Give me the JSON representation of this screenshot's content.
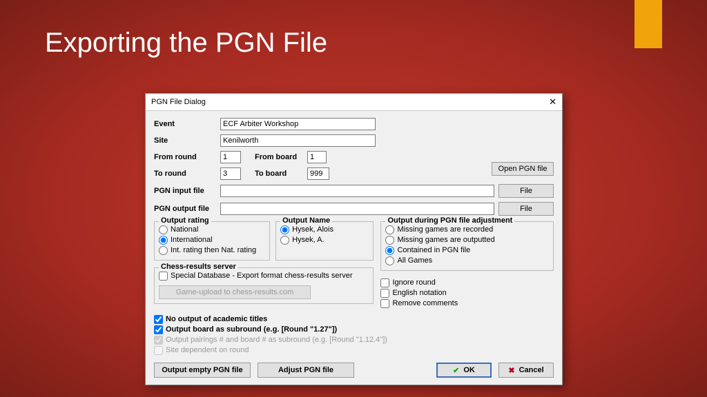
{
  "slide": {
    "title": "Exporting the PGN File"
  },
  "dialog": {
    "title": "PGN File Dialog",
    "labels": {
      "event": "Event",
      "site": "Site",
      "from_round": "From round",
      "from_board": "From board",
      "to_round": "To round",
      "to_board": "To board",
      "pgn_input": "PGN input file",
      "pgn_output": "PGN output file"
    },
    "values": {
      "event": "ECF Arbiter Workshop",
      "site": "Kenilworth",
      "from_round": "1",
      "from_board": "1",
      "to_round": "3",
      "to_board": "999",
      "pgn_input": "",
      "pgn_output": ""
    },
    "buttons": {
      "open_pgn": "Open PGN file",
      "file": "File",
      "upload": "Game-upload to chess-results.com",
      "output_empty": "Output empty PGN file",
      "adjust": "Adjust PGN file",
      "ok": "OK",
      "cancel": "Cancel"
    },
    "groups": {
      "output_rating": {
        "legend": "Output rating",
        "options": [
          "National",
          "International",
          "Int. rating then Nat. rating"
        ],
        "selected": 1
      },
      "output_name": {
        "legend": "Output Name",
        "options": [
          "Hysek, Alois",
          "Hysek, A."
        ],
        "selected": 0
      },
      "output_adj": {
        "legend": "Output during PGN file adjustment",
        "options": [
          "Missing games are recorded",
          "Missing games are outputted",
          "Contained in PGN file",
          "All Games"
        ],
        "selected": 2
      },
      "chess_results": {
        "legend": "Chess-results server",
        "special_db": "Special Database - Export format chess-results server",
        "special_db_checked": false
      },
      "extra_checks": {
        "ignore_round": {
          "label": "Ignore round",
          "checked": false
        },
        "english_notation": {
          "label": "English notation",
          "checked": false
        },
        "remove_comments": {
          "label": "Remove comments",
          "checked": false
        }
      }
    },
    "bottom_checks": {
      "no_academic": {
        "label": "No output of academic titles",
        "checked": true
      },
      "subround": {
        "label": "Output board as subround (e.g. [Round \"1.27\"])",
        "checked": true
      },
      "pairings": {
        "label": "Output pairings # and board # as subround (e.g. [Round \"1.12.4\"])",
        "checked": true,
        "disabled": true
      },
      "site_dep": {
        "label": "Site dependent on round",
        "checked": false,
        "disabled": true
      }
    }
  }
}
